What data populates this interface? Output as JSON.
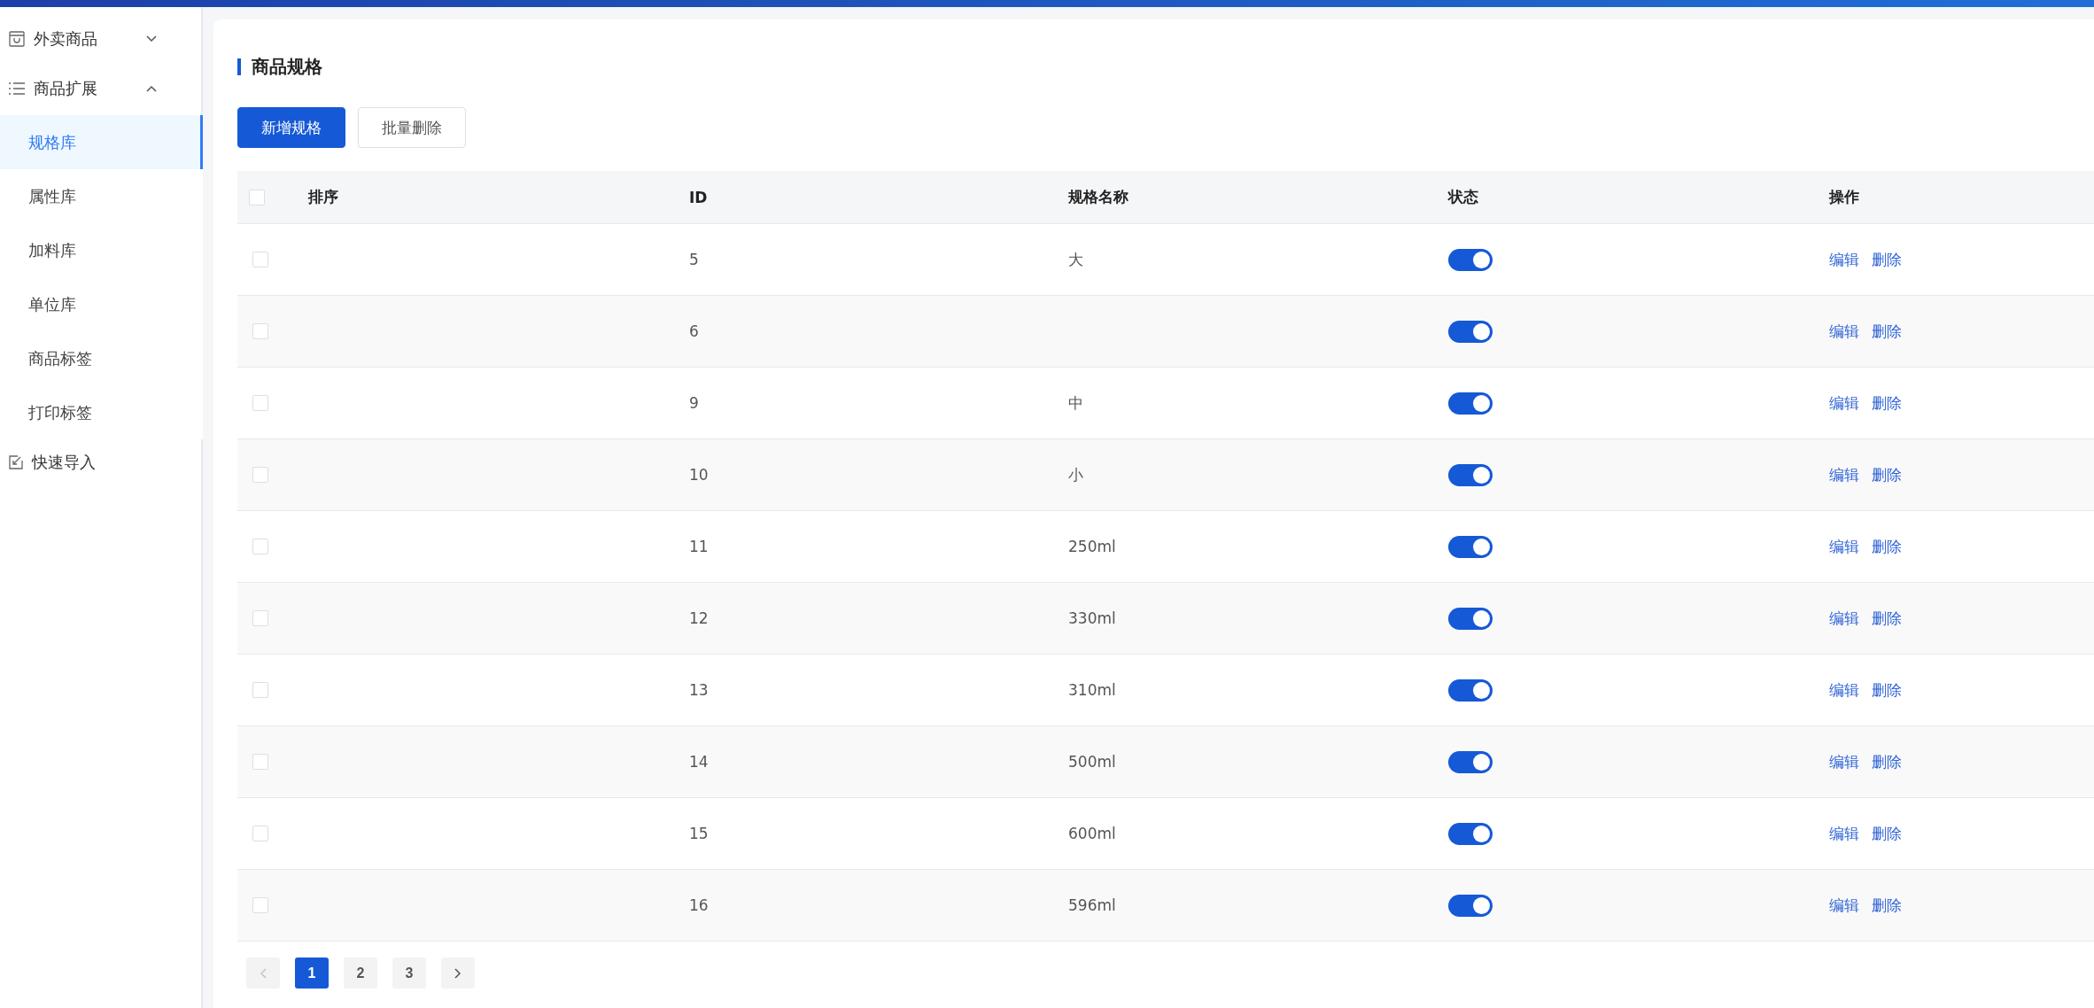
{
  "sidebar": {
    "groups": [
      {
        "label": "外卖商品",
        "expanded": false
      },
      {
        "label": "商品扩展",
        "expanded": true,
        "items": [
          {
            "label": "规格库",
            "selected": true
          },
          {
            "label": "属性库",
            "selected": false
          },
          {
            "label": "加料库",
            "selected": false
          },
          {
            "label": "单位库",
            "selected": false
          },
          {
            "label": "商品标签",
            "selected": false
          },
          {
            "label": "打印标签",
            "selected": false
          }
        ]
      },
      {
        "label": "快速导入"
      }
    ]
  },
  "page": {
    "title": "商品规格",
    "buttons": [
      {
        "label": "新增规格",
        "kind": "primary"
      },
      {
        "label": "批量删除",
        "kind": "default"
      }
    ]
  },
  "table": {
    "columns": [
      "排序",
      "ID",
      "规格名称",
      "状态",
      "操作"
    ],
    "header_checked": false,
    "rows": [
      {
        "checked": false,
        "id": "5",
        "name": "大",
        "on": true,
        "actions": [
          "编辑",
          "删除"
        ]
      },
      {
        "checked": false,
        "id": "6",
        "on": true,
        "actions": [
          "编辑",
          "删除"
        ]
      },
      {
        "checked": false,
        "id": "9",
        "name": "中",
        "on": true,
        "actions": [
          "编辑",
          "删除"
        ]
      },
      {
        "checked": false,
        "id": "10",
        "name": "小",
        "on": true,
        "actions": [
          "编辑",
          "删除"
        ]
      },
      {
        "checked": false,
        "id": "11",
        "name": "250ml",
        "on": true,
        "actions": [
          "编辑",
          "删除"
        ]
      },
      {
        "checked": false,
        "id": "12",
        "name": "330ml",
        "on": true,
        "actions": [
          "编辑",
          "删除"
        ]
      },
      {
        "checked": false,
        "id": "13",
        "name": "310ml",
        "on": true,
        "actions": [
          "编辑",
          "删除"
        ]
      },
      {
        "checked": false,
        "id": "14",
        "name": "500ml",
        "on": true,
        "actions": [
          "编辑",
          "删除"
        ]
      },
      {
        "checked": false,
        "id": "15",
        "name": "600ml",
        "on": true,
        "actions": [
          "编辑",
          "删除"
        ]
      },
      {
        "checked": false,
        "id": "16",
        "name": "596ml",
        "on": true,
        "actions": [
          "编辑",
          "删除"
        ]
      }
    ]
  },
  "pagination": {
    "prev_disabled": true,
    "pages": [
      {
        "label": "1",
        "selected": true
      },
      {
        "label": "2",
        "selected": false
      },
      {
        "label": "3",
        "selected": false
      }
    ]
  }
}
